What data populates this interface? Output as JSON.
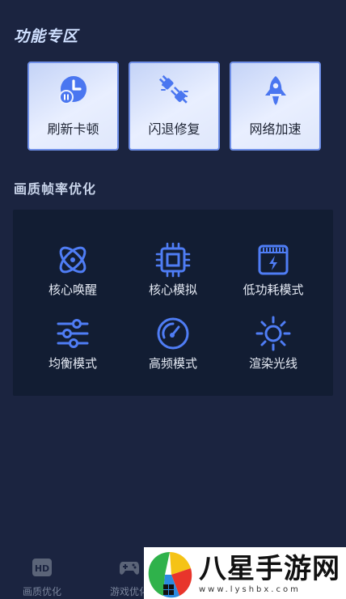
{
  "sections": {
    "function_title": "功能专区",
    "fps_title": "画质帧率优化"
  },
  "function_cards": [
    {
      "label": "刷新卡顿",
      "icon": "clock-pause-icon"
    },
    {
      "label": "闪退修复",
      "icon": "plug-icon"
    },
    {
      "label": "网络加速",
      "icon": "rocket-icon"
    }
  ],
  "modes": [
    {
      "label": "核心唤醒",
      "icon": "atom-icon"
    },
    {
      "label": "核心模拟",
      "icon": "cpu-chip-icon"
    },
    {
      "label": "低功耗模式",
      "icon": "battery-bolt-icon"
    },
    {
      "label": "均衡模式",
      "icon": "sliders-icon"
    },
    {
      "label": "高频模式",
      "icon": "speedometer-icon"
    },
    {
      "label": "渲染光线",
      "icon": "sun-icon"
    }
  ],
  "bottom_nav": [
    {
      "label": "画质优化",
      "icon": "hd-icon"
    },
    {
      "label": "游戏优化",
      "icon": "gamepad-icon"
    }
  ],
  "watermark": {
    "text": "八星手游网",
    "url": "www.lyshbx.com"
  },
  "colors": {
    "background": "#1b2440",
    "panel": "#121d33",
    "accent_blue": "#4f7df5",
    "card_border": "#6f8fe8"
  }
}
